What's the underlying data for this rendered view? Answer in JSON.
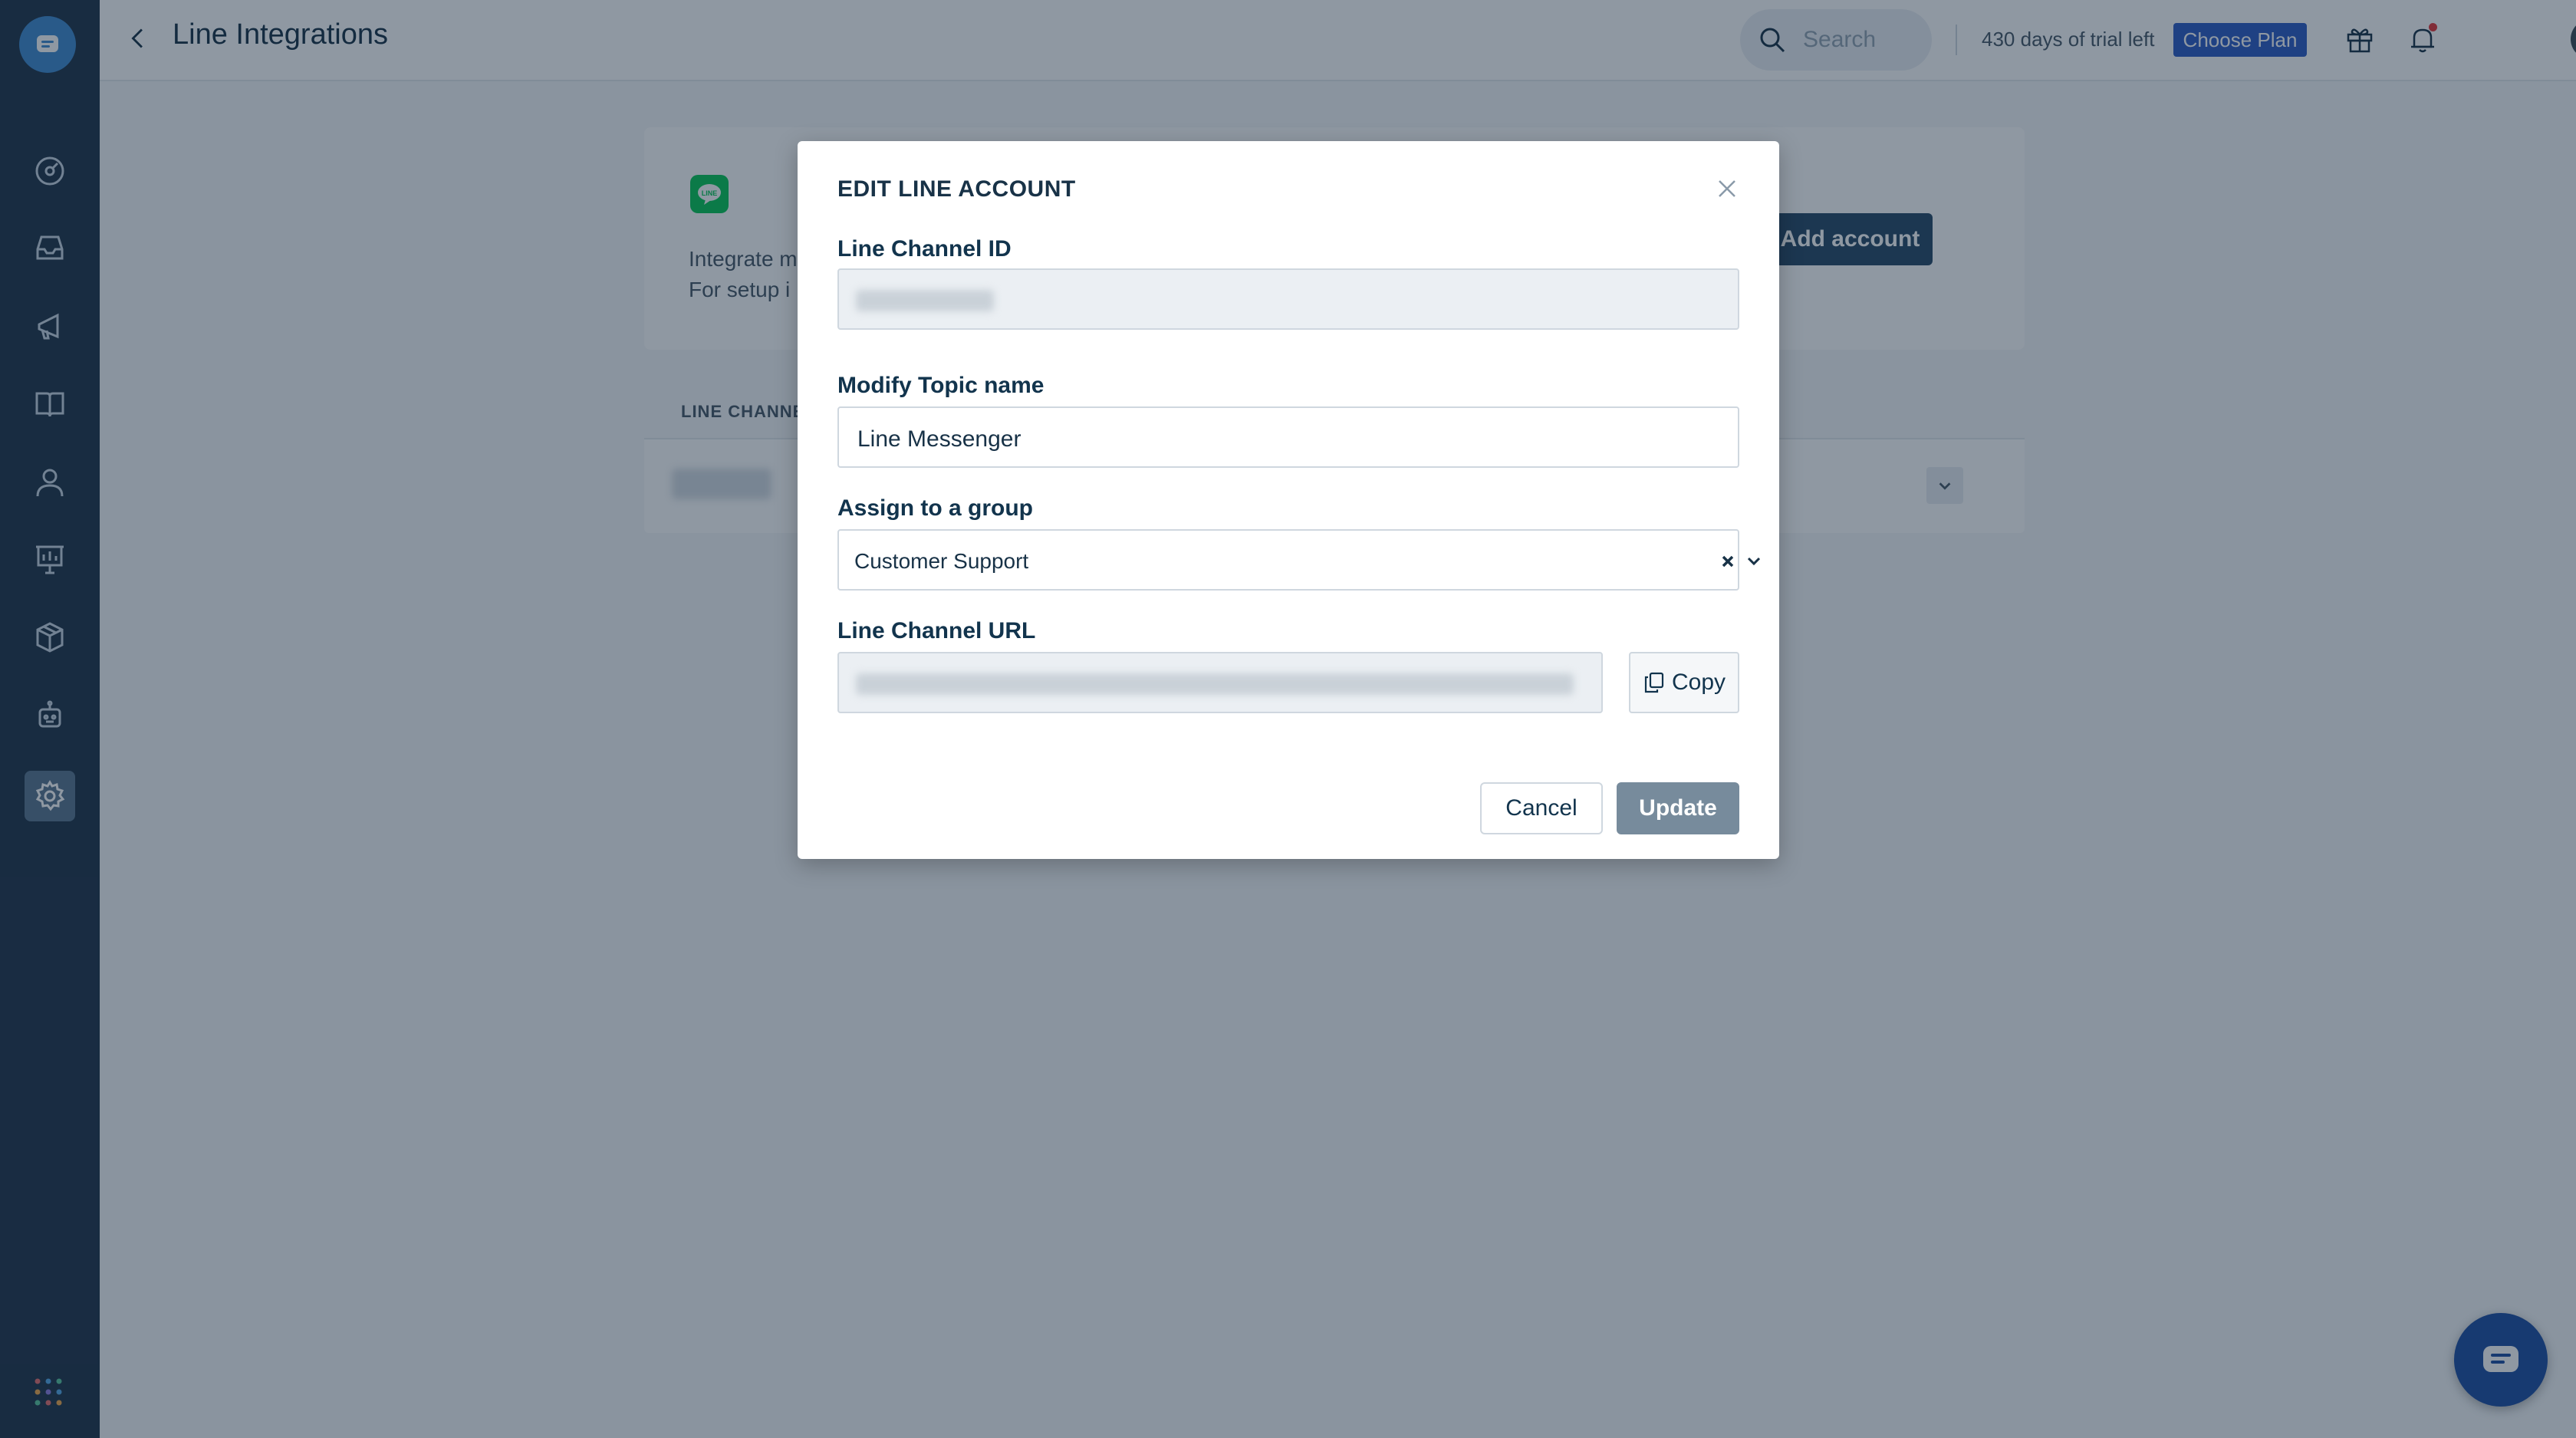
{
  "header": {
    "page_title": "Line Integrations",
    "search_placeholder": "Search",
    "trial_text": "430 days of trial left",
    "choose_plan_label": "Choose Plan"
  },
  "sidebar": {
    "items": [
      {
        "icon": "dashboard-icon"
      },
      {
        "icon": "inbox-icon"
      },
      {
        "icon": "campaigns-icon"
      },
      {
        "icon": "knowledge-base-icon"
      },
      {
        "icon": "contacts-icon"
      },
      {
        "icon": "reports-icon"
      },
      {
        "icon": "integrations-icon"
      },
      {
        "icon": "bot-icon"
      },
      {
        "icon": "settings-icon",
        "active": true
      }
    ]
  },
  "integration_card": {
    "description_line1": "Integrate m",
    "description_line2": "For setup i",
    "add_account_label": "Add account"
  },
  "table": {
    "header": "LINE CHANNE"
  },
  "modal": {
    "title": "EDIT LINE ACCOUNT",
    "channel_id_label": "Line Channel ID",
    "topic_label": "Modify Topic name",
    "topic_value": "Line Messenger",
    "group_label": "Assign to a group",
    "group_value": "Customer Support",
    "channel_url_label": "Line Channel URL",
    "copy_label": "Copy",
    "cancel_label": "Cancel",
    "update_label": "Update"
  },
  "colors": {
    "sidebar_bg": "#1f3449",
    "primary_button": "#264966",
    "choose_plan": "#2c5cc5",
    "line_green": "#06c755",
    "update_disabled": "#778b9c",
    "chat_widget": "#1d4ea3"
  }
}
